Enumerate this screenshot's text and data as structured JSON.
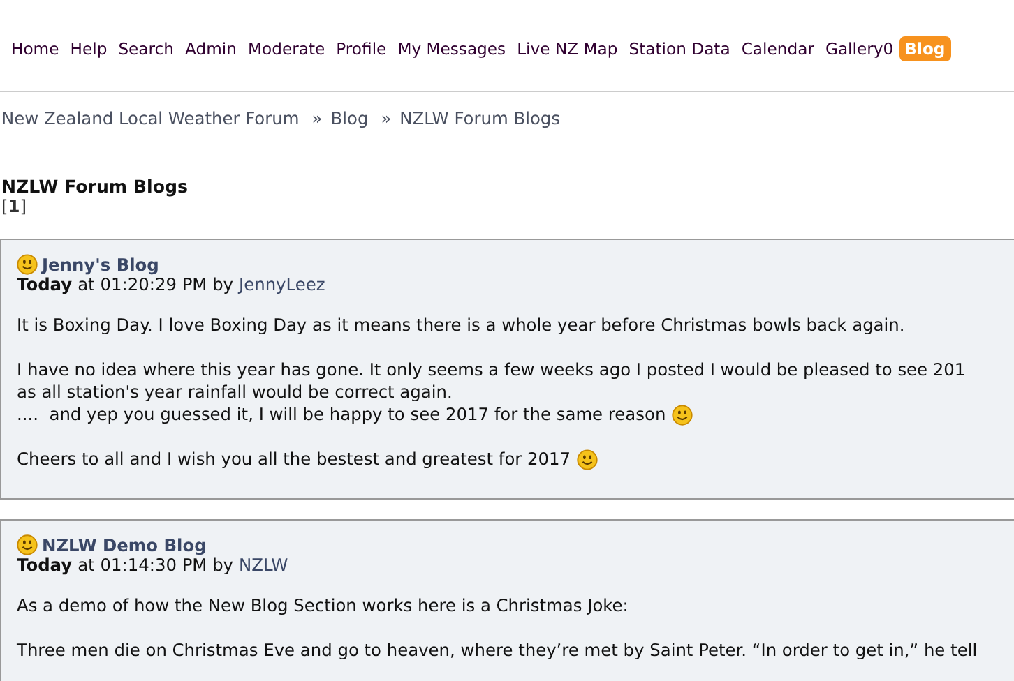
{
  "nav": [
    {
      "label": "Home",
      "selected": false
    },
    {
      "label": "Help",
      "selected": false
    },
    {
      "label": "Search",
      "selected": false
    },
    {
      "label": "Admin",
      "selected": false
    },
    {
      "label": "Moderate",
      "selected": false
    },
    {
      "label": "Profile",
      "selected": false
    },
    {
      "label": "My Messages",
      "selected": false
    },
    {
      "label": "Live NZ Map",
      "selected": false
    },
    {
      "label": "Station Data",
      "selected": false
    },
    {
      "label": "Calendar",
      "selected": false
    },
    {
      "label": "Gallery0",
      "selected": false
    },
    {
      "label": "Blog",
      "selected": true
    }
  ],
  "breadcrumb": [
    {
      "label": "New Zealand Local Weather Forum",
      "kind": "link"
    },
    {
      "label": "»",
      "kind": "separator"
    },
    {
      "label": "Blog",
      "kind": "link"
    },
    {
      "label": "»",
      "kind": "separator"
    },
    {
      "label": "NZLW Forum Blogs",
      "kind": "link"
    }
  ],
  "heading": "NZLW Forum Blogs",
  "pages": "[**1**]",
  "posts": [
    {
      "title": "Jenny's Blog",
      "day": "Today",
      "time": "at 01:20:29 PM by",
      "author": "JennyLeez",
      "paragraphs": [
        {
          "lines": [
            {
              "text": "It is Boxing Day. I love Boxing Day as it means there is a whole year before Christmas bowls back again.",
              "emoticon": false
            }
          ]
        },
        {
          "lines": [
            {
              "text": "I have no idea where this year has gone. It only seems a few weeks ago I posted I would be pleased to see 201",
              "emoticon": false
            },
            {
              "text": "as all station's year rainfall would be correct again.",
              "emoticon": false
            },
            {
              "text": "....  and yep you guessed it, I will be happy to see 2017 for the same reason",
              "emoticon": true
            }
          ]
        },
        {
          "lines": [
            {
              "text": "Cheers to all and I wish you all the bestest and greatest for 2017",
              "emoticon": true
            }
          ]
        }
      ]
    },
    {
      "title": "NZLW Demo Blog",
      "day": "Today",
      "time": "at 01:14:30 PM by",
      "author": "NZLW",
      "paragraphs": [
        {
          "lines": [
            {
              "text": "As a demo of how the New Blog Section works here is a Christmas Joke:",
              "emoticon": false
            }
          ]
        },
        {
          "lines": [
            {
              "text": "Three men die on Christmas Eve and go to heaven, where they’re met by Saint Peter. “In order to get in,” he tell",
              "emoticon": false
            }
          ]
        }
      ]
    }
  ]
}
